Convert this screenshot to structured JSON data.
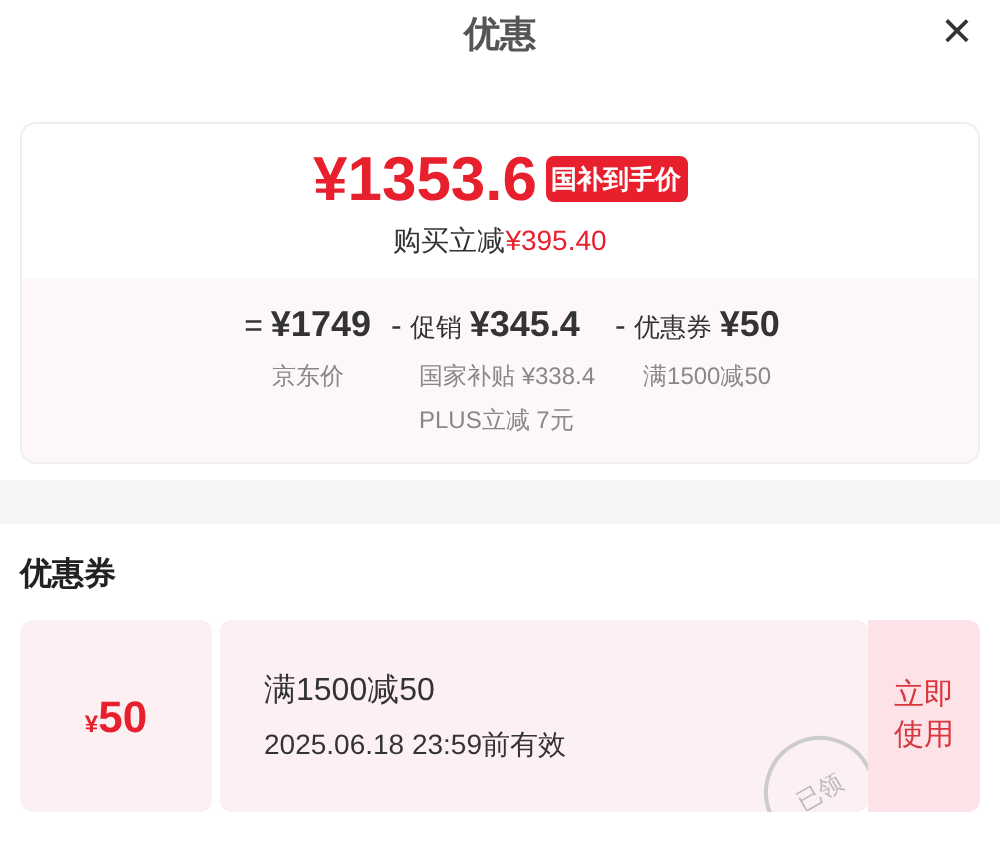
{
  "header": {
    "title": "优惠",
    "close": "×"
  },
  "summary": {
    "price": "¥1353.6",
    "badge": "国补到手价",
    "savings_label": "购买立减",
    "savings_amount": "¥395.40"
  },
  "breakdown": [
    {
      "operator": "=",
      "amount": "¥1749",
      "details": [
        "京东价"
      ]
    },
    {
      "operator": "-",
      "label": "促销",
      "amount": "¥345.4",
      "details": [
        "国家补贴 ¥338.4",
        "PLUS立减 7元"
      ]
    },
    {
      "operator": "-",
      "label": "优惠券",
      "amount": "¥50",
      "details": [
        "满1500减50"
      ]
    }
  ],
  "coupons_section": {
    "title": "优惠券",
    "coupons": [
      {
        "currency": "¥",
        "amount": "50",
        "condition": "满1500减50",
        "validity": "2025.06.18 23:59前有效",
        "claimed": true,
        "stamp": "已领",
        "action": "立即使用"
      }
    ]
  }
}
